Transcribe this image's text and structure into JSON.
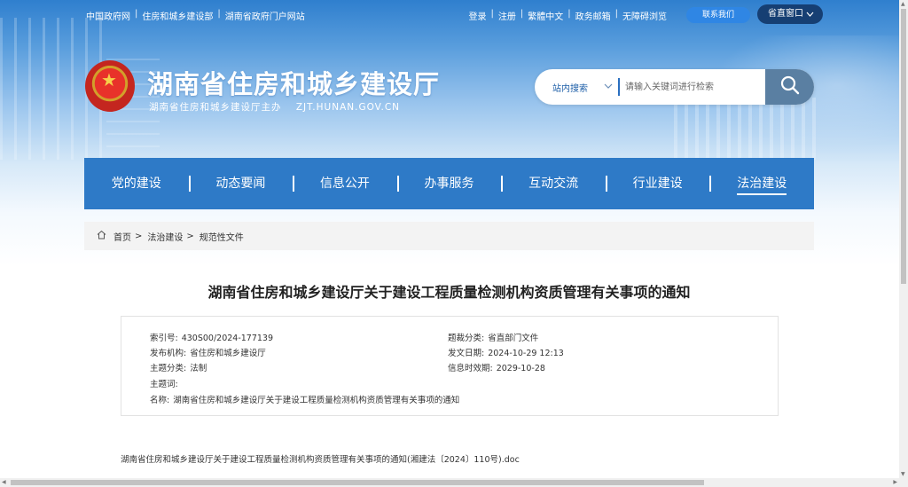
{
  "topbar": {
    "left_links": [
      "中国政府网",
      "住房和城乡建设部",
      "湖南省政府门户网站"
    ],
    "right_links": [
      "登录",
      "注册",
      "繁體中文",
      "政务邮箱",
      "无障碍浏览"
    ],
    "contact_label": "联系我们",
    "portal_label": "省直窗口"
  },
  "header": {
    "title": "湖南省住房和城乡建设厅",
    "subtitle": "湖南省住房和城乡建设厅主办",
    "url": "ZJT.HUNAN.GOV.CN"
  },
  "search": {
    "scope": "站内搜索",
    "placeholder": "请输入关键词进行检索"
  },
  "nav": {
    "items": [
      "党的建设",
      "动态要闻",
      "信息公开",
      "办事服务",
      "互动交流",
      "行业建设",
      "法治建设"
    ],
    "active": "法治建设"
  },
  "breadcrumb": [
    "首页",
    "法治建设",
    "规范性文件"
  ],
  "article": {
    "title": "湖南省住房和城乡建设厅关于建设工程质量检测机构资质管理有关事项的通知",
    "meta": {
      "index_label": "索引号:",
      "index_value": "430S00/2024-177139",
      "category_label": "题裁分类:",
      "category_value": "省直部门文件",
      "publisher_label": "发布机构:",
      "publisher_value": "省住房和城乡建设厅",
      "date_label": "发文日期:",
      "date_value": "2024-10-29 12:13",
      "topic_label": "主题分类:",
      "topic_value": "法制",
      "expiry_label": "信息时效期:",
      "expiry_value": "2029-10-28",
      "keywords_label": "主题词:",
      "keywords_value": "",
      "name_label": "名称:",
      "name_value": "湖南省住房和城乡建设厅关于建设工程质量检测机构资质管理有关事项的通知"
    },
    "attachment": "湖南省住房和城乡建设厅关于建设工程质量检测机构资质管理有关事项的通知(湘建法〔2024〕110号).doc"
  },
  "colors": {
    "nav_bg": "#2e7ac7",
    "portal_bg": "#163f73",
    "contact_bg": "#2f86e4",
    "search_btn_bg": "#5a7fa2"
  }
}
